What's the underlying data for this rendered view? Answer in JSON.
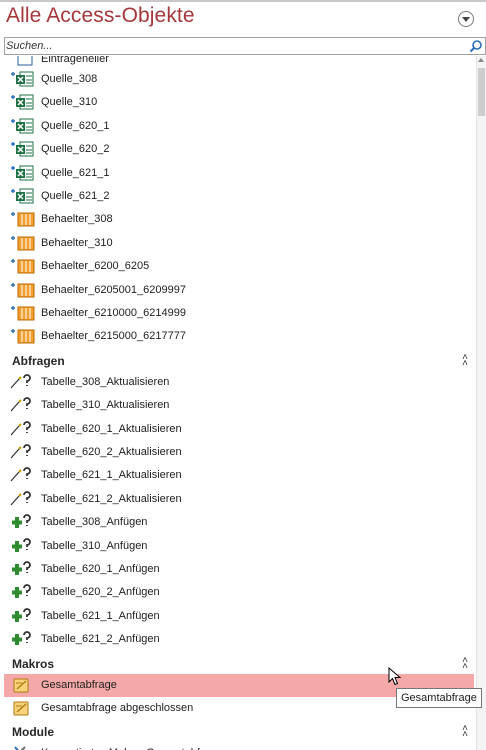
{
  "pane": {
    "title": "Alle Access-Objekte",
    "menu_icon": "chevron-down-icon"
  },
  "search": {
    "placeholder": "Suchen...",
    "icon": "search-icon"
  },
  "tables": {
    "partial_item": "Eintrageneiler",
    "items": [
      {
        "label": "Quelle_308",
        "icon": "linked-excel-table-icon"
      },
      {
        "label": "Quelle_310",
        "icon": "linked-excel-table-icon"
      },
      {
        "label": "Quelle_620_1",
        "icon": "linked-excel-table-icon"
      },
      {
        "label": "Quelle_620_2",
        "icon": "linked-excel-table-icon"
      },
      {
        "label": "Quelle_621_1",
        "icon": "linked-excel-table-icon"
      },
      {
        "label": "Quelle_621_2",
        "icon": "linked-excel-table-icon"
      },
      {
        "label": "Behaelter_308",
        "icon": "linked-table-icon"
      },
      {
        "label": "Behaelter_310",
        "icon": "linked-table-icon"
      },
      {
        "label": "Behaelter_6200_6205",
        "icon": "linked-table-icon"
      },
      {
        "label": "Behaelter_6205001_6209997",
        "icon": "linked-table-icon"
      },
      {
        "label": "Behaelter_6210000_6214999",
        "icon": "linked-table-icon"
      },
      {
        "label": "Behaelter_6215000_6217777",
        "icon": "linked-table-icon"
      }
    ]
  },
  "queries": {
    "title": "Abfragen",
    "items": [
      {
        "label": "Tabelle_308_Aktualisieren",
        "icon": "update-query-icon"
      },
      {
        "label": "Tabelle_310_Aktualisieren",
        "icon": "update-query-icon"
      },
      {
        "label": "Tabelle_620_1_Aktualisieren",
        "icon": "update-query-icon"
      },
      {
        "label": "Tabelle_620_2_Aktualisieren",
        "icon": "update-query-icon"
      },
      {
        "label": "Tabelle_621_1_Aktualisieren",
        "icon": "update-query-icon"
      },
      {
        "label": "Tabelle_621_2_Aktualisieren",
        "icon": "update-query-icon"
      },
      {
        "label": "Tabelle_308_Anfügen",
        "icon": "append-query-icon"
      },
      {
        "label": "Tabelle_310_Anfügen",
        "icon": "append-query-icon"
      },
      {
        "label": "Tabelle_620_1_Anfügen",
        "icon": "append-query-icon"
      },
      {
        "label": "Tabelle_620_2_Anfügen",
        "icon": "append-query-icon"
      },
      {
        "label": "Tabelle_621_1_Anfügen",
        "icon": "append-query-icon"
      },
      {
        "label": "Tabelle_621_2_Anfügen",
        "icon": "append-query-icon"
      }
    ]
  },
  "macros": {
    "title": "Makros",
    "items": [
      {
        "label": "Gesamtabfrage",
        "icon": "macro-icon",
        "selected": true
      },
      {
        "label": "Gesamtabfrage abgeschlossen",
        "icon": "macro-icon",
        "selected": false
      }
    ]
  },
  "modules": {
    "title": "Module",
    "items": [
      {
        "label": "Konvertiertes Makro- Gesamtabfrage",
        "icon": "module-icon"
      }
    ]
  },
  "tooltip": {
    "text": "Gesamtabfrage"
  },
  "colors": {
    "title": "#a4373a",
    "selection": "#f4a8a8",
    "excel_green": "#1e7145",
    "table_orange": "#f0a030"
  }
}
